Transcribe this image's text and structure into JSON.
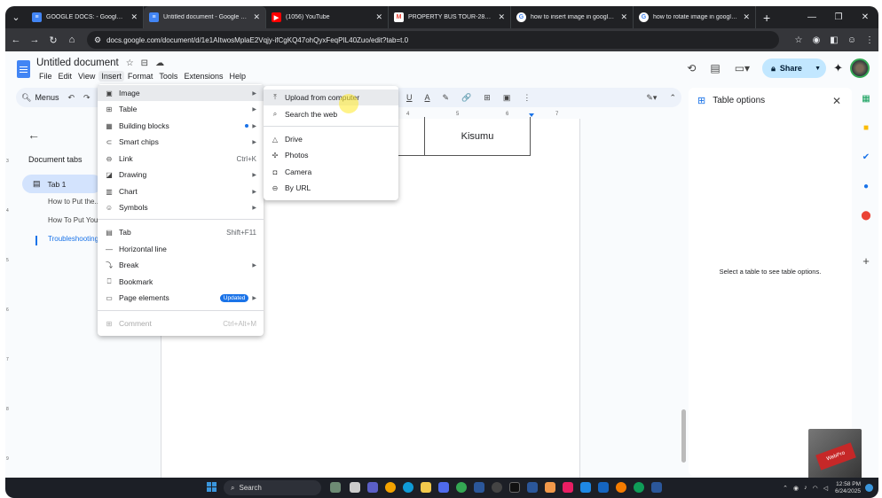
{
  "browser": {
    "tabs": [
      {
        "title": "GOOGLE DOCS: - Google Docs",
        "icon": "docs-icon",
        "active": false
      },
      {
        "title": "Untitled document - Google Docs",
        "icon": "docs-icon",
        "active": true
      },
      {
        "title": "(1056) YouTube",
        "icon": "youtube-icon",
        "active": false
      },
      {
        "title": "PROPERTY BUS TOUR-28TH JUNE",
        "icon": "gmail-icon",
        "active": false
      },
      {
        "title": "how to insert image in google do...",
        "icon": "google-icon",
        "active": false
      },
      {
        "title": "how to rotate image in google do...",
        "icon": "google-icon",
        "active": false
      }
    ],
    "url": "docs.google.com/document/d/1e1AItwosMplaE2Vqjy-ifCgKQ47ohQyxFeqPIL40Zuo/edit?tab=t.0"
  },
  "doc": {
    "title": "Untitled document",
    "menus": [
      "File",
      "Edit",
      "View",
      "Insert",
      "Format",
      "Tools",
      "Extensions",
      "Help"
    ],
    "share_label": "Share"
  },
  "toolbar": {
    "menus_label": "Menus",
    "format_glyphs": [
      "U",
      "A",
      "✎",
      "🔗",
      "⊞",
      "▣",
      "⋮"
    ]
  },
  "ruler": {
    "ticks": [
      "4",
      "5",
      "6",
      "7"
    ]
  },
  "outline": {
    "title": "Document tabs",
    "tab_label": "Tab 1",
    "headings": [
      "How to Put the...",
      "How To Put You...",
      "Troubleshooting..."
    ]
  },
  "table": {
    "cell_text": "Kisumu"
  },
  "insert_menu": {
    "items": [
      {
        "label": "Image",
        "icon": "image-icon",
        "shortcut": "",
        "arrow": true
      },
      {
        "label": "Table",
        "icon": "table-icon",
        "shortcut": "",
        "arrow": true
      },
      {
        "label": "Building blocks",
        "icon": "building-blocks-icon",
        "shortcut": "",
        "arrow": true
      },
      {
        "label": "Smart chips",
        "icon": "smart-chips-icon",
        "shortcut": "",
        "arrow": true
      },
      {
        "label": "Link",
        "icon": "link-icon",
        "shortcut": "Ctrl+K",
        "arrow": false
      },
      {
        "label": "Drawing",
        "icon": "drawing-icon",
        "shortcut": "",
        "arrow": true
      },
      {
        "label": "Chart",
        "icon": "chart-icon",
        "shortcut": "",
        "arrow": true
      },
      {
        "label": "Symbols",
        "icon": "symbols-icon",
        "shortcut": "",
        "arrow": true
      },
      {
        "label": "Tab",
        "icon": "tab-icon",
        "shortcut": "Shift+F11",
        "arrow": false
      },
      {
        "label": "Horizontal line",
        "icon": "horizontal-line-icon",
        "shortcut": "",
        "arrow": false
      },
      {
        "label": "Break",
        "icon": "break-icon",
        "shortcut": "",
        "arrow": true
      },
      {
        "label": "Bookmark",
        "icon": "bookmark-icon",
        "shortcut": "",
        "arrow": false
      },
      {
        "label": "Page elements",
        "icon": "page-elements-icon",
        "shortcut": "",
        "arrow": true,
        "badge": "Updated"
      },
      {
        "label": "Comment",
        "icon": "comment-icon",
        "shortcut": "Ctrl+Alt+M",
        "arrow": false,
        "disabled": true
      }
    ]
  },
  "image_submenu": {
    "items": [
      {
        "label": "Upload from computer",
        "icon": "upload-icon"
      },
      {
        "label": "Search the web",
        "icon": "search-icon"
      },
      {
        "label": "Drive",
        "icon": "drive-icon"
      },
      {
        "label": "Photos",
        "icon": "photos-icon"
      },
      {
        "label": "Camera",
        "icon": "camera-icon"
      },
      {
        "label": "By URL",
        "icon": "link-icon"
      }
    ]
  },
  "table_options": {
    "title": "Table options",
    "message": "Select a table to see table options."
  },
  "watermark": {
    "text": "WebPro"
  },
  "taskbar": {
    "search_label": "Search",
    "time": "12:58 PM",
    "date": "6/24/2025"
  },
  "colors": {
    "accent": "#1a73e8",
    "share_bg": "#c2e7ff",
    "tab_selected": "#d3e3fd"
  }
}
